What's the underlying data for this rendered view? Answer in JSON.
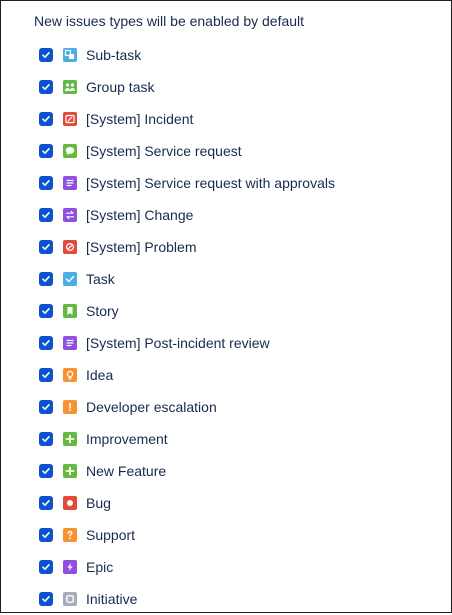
{
  "header": {
    "title": "New issues types will be enabled by default"
  },
  "colors": {
    "checkbox": "#0c52cc",
    "text": "#172b4d"
  },
  "issue_types": [
    {
      "label": "Sub-task",
      "icon": "subtask-icon",
      "color": "#4bade8",
      "checked": true
    },
    {
      "label": "Group task",
      "icon": "group-task-icon",
      "color": "#5eba47",
      "checked": true
    },
    {
      "label": "[System] Incident",
      "icon": "incident-icon",
      "color": "#e5493a",
      "checked": true
    },
    {
      "label": "[System] Service request",
      "icon": "service-request-icon",
      "color": "#63ba3c",
      "checked": true
    },
    {
      "label": "[System] Service request with approvals",
      "icon": "service-request-approvals-icon",
      "color": "#904ee2",
      "checked": true
    },
    {
      "label": "[System] Change",
      "icon": "change-icon",
      "color": "#904ee2",
      "checked": true
    },
    {
      "label": "[System] Problem",
      "icon": "problem-icon",
      "color": "#e5493a",
      "checked": true
    },
    {
      "label": "Task",
      "icon": "task-icon",
      "color": "#4bade8",
      "checked": true
    },
    {
      "label": "Story",
      "icon": "story-icon",
      "color": "#63ba3c",
      "checked": true
    },
    {
      "label": "[System] Post-incident review",
      "icon": "post-incident-review-icon",
      "color": "#904ee2",
      "checked": true
    },
    {
      "label": "Idea",
      "icon": "idea-icon",
      "color": "#f79232",
      "checked": true
    },
    {
      "label": "Developer escalation",
      "icon": "developer-escalation-icon",
      "color": "#f79232",
      "checked": true
    },
    {
      "label": "Improvement",
      "icon": "improvement-icon",
      "color": "#63ba3c",
      "checked": true
    },
    {
      "label": "New Feature",
      "icon": "new-feature-icon",
      "color": "#63ba3c",
      "checked": true
    },
    {
      "label": "Bug",
      "icon": "bug-icon",
      "color": "#e5493a",
      "checked": true
    },
    {
      "label": "Support",
      "icon": "support-icon",
      "color": "#f79232",
      "checked": true
    },
    {
      "label": "Epic",
      "icon": "epic-icon",
      "color": "#904ee2",
      "checked": true
    },
    {
      "label": "Initiative",
      "icon": "initiative-icon",
      "color": "#a5adba",
      "checked": true
    }
  ]
}
